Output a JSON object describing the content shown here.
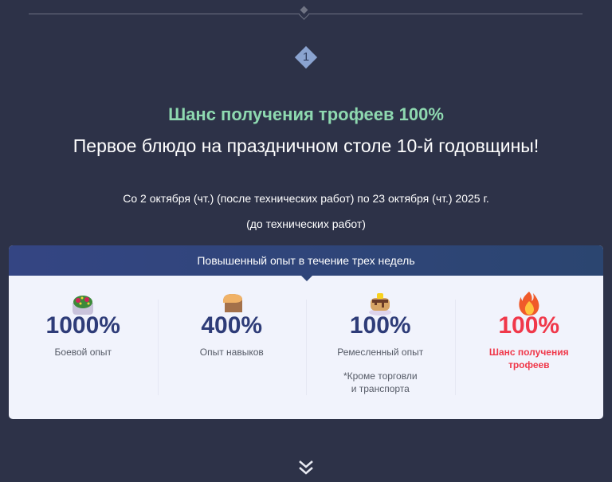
{
  "step_number": "1",
  "title": "Шанс получения трофеев 100%",
  "subtitle": "Первое блюдо на праздничном столе 10-й годовщины!",
  "date_line1": "Со 2 октября (чт.) (после технических работ) по 23 октября (чт.) 2025 г.",
  "date_line2": "(до технических работ)",
  "card": {
    "header": "Повышенный опыт в течение трех недель",
    "items": [
      {
        "icon": "salad-icon",
        "value": "1000%",
        "label": "Боевой опыт"
      },
      {
        "icon": "bread-icon",
        "value": "400%",
        "label": "Опыт навыков"
      },
      {
        "icon": "pancake-icon",
        "value": "100%",
        "label": "Ремесленный опыт",
        "note1": "*Кроме торговли",
        "note2": "и транспорта"
      },
      {
        "icon": "fire-icon",
        "value": "100%",
        "label1": "Шанс получения",
        "label2": "трофеев"
      }
    ]
  },
  "colors": {
    "background": "#2d3248",
    "accent_green": "#8ed9b0",
    "accent_red": "#f0384a",
    "value_blue": "#2e3c78"
  }
}
